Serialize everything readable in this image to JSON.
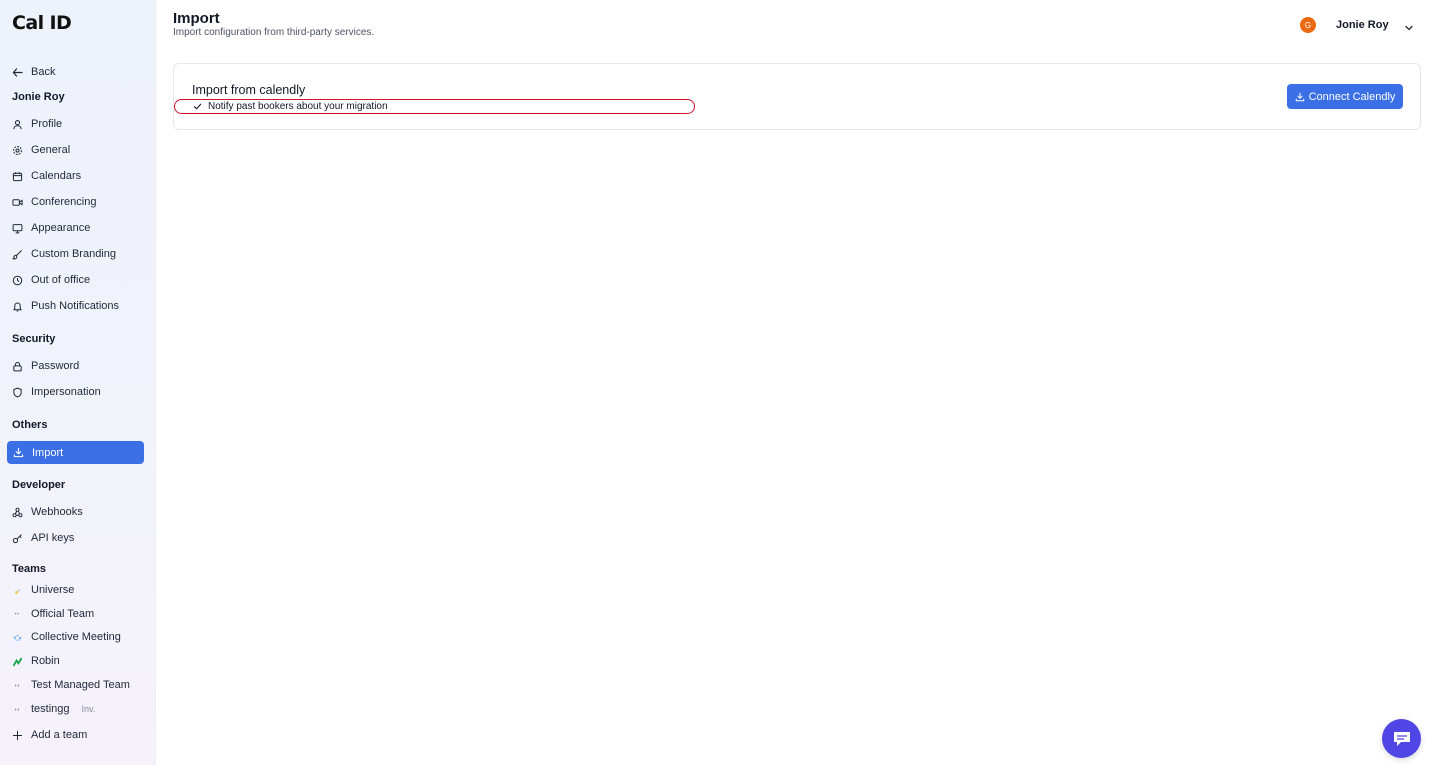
{
  "app": {
    "logo": "Cal ID"
  },
  "sidebar": {
    "back_label": "Back",
    "user_section": "Jonie Roy",
    "account_items": [
      {
        "label": "Profile",
        "icon": "user-icon"
      },
      {
        "label": "General",
        "icon": "gear-icon"
      },
      {
        "label": "Calendars",
        "icon": "calendar-icon"
      },
      {
        "label": "Conferencing",
        "icon": "video-icon"
      },
      {
        "label": "Appearance",
        "icon": "monitor-icon"
      },
      {
        "label": "Custom Branding",
        "icon": "brush-icon"
      },
      {
        "label": "Out of office",
        "icon": "clock-icon"
      },
      {
        "label": "Push Notifications",
        "icon": "bell-icon"
      }
    ],
    "security_section": "Security",
    "security_items": [
      {
        "label": "Password",
        "icon": "lock-icon"
      },
      {
        "label": "Impersonation",
        "icon": "shield-icon"
      }
    ],
    "others_section": "Others",
    "others_items": [
      {
        "label": "Import",
        "icon": "download-icon",
        "active": true
      }
    ],
    "developer_section": "Developer",
    "developer_items": [
      {
        "label": "Webhooks",
        "icon": "webhook-icon"
      },
      {
        "label": "API keys",
        "icon": "key-icon"
      }
    ],
    "teams_section": "Teams",
    "teams": [
      {
        "label": "Universe"
      },
      {
        "label": "Official Team"
      },
      {
        "label": "Collective Meeting"
      },
      {
        "label": "Robin"
      },
      {
        "label": "Test Managed Team"
      },
      {
        "label": "testingg",
        "badge": "Inv."
      }
    ],
    "add_team_label": "Add a team"
  },
  "header": {
    "title": "Import",
    "subtitle": "Import configuration from third-party services.",
    "user": {
      "avatar_initial": "G",
      "name": "Jonie Roy"
    }
  },
  "import_card": {
    "title": "Import from calendly",
    "notify_label": "Notify past bookers about your migration",
    "connect_button": "Connect Calendly"
  },
  "colors": {
    "primary": "#3b6fe6",
    "avatar": "#ea6a12",
    "highlight": "#d2142a",
    "chat": "#4f46e5"
  }
}
